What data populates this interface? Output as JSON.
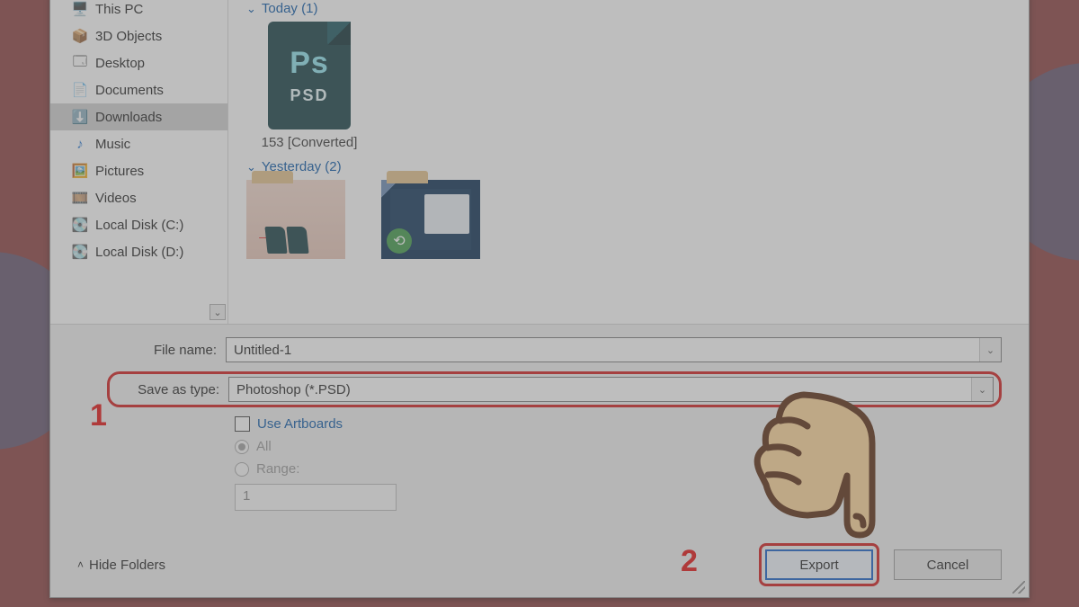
{
  "sidebar": {
    "items": [
      {
        "label": "This PC",
        "icon": "🖥️"
      },
      {
        "label": "3D Objects",
        "icon": "📦"
      },
      {
        "label": "Desktop",
        "icon": "🗔"
      },
      {
        "label": "Documents",
        "icon": "📄"
      },
      {
        "label": "Downloads",
        "icon": "⬇️",
        "selected": true
      },
      {
        "label": "Music",
        "icon": "♪"
      },
      {
        "label": "Pictures",
        "icon": "🖼️"
      },
      {
        "label": "Videos",
        "icon": "🎞️"
      },
      {
        "label": "Local Disk (C:)",
        "icon": "💽"
      },
      {
        "label": "Local Disk (D:)",
        "icon": "💽"
      }
    ]
  },
  "filearea": {
    "groups": [
      {
        "label": "Today (1)"
      },
      {
        "label": "Yesterday (2)"
      }
    ],
    "psd_file": {
      "label": "153 [Converted]",
      "ps": "Ps",
      "psd": "PSD"
    }
  },
  "form": {
    "filename_label": "File name:",
    "filename_value": "Untitled-1",
    "savetype_label": "Save as type:",
    "savetype_value": "Photoshop (*.PSD)",
    "use_artboards": "Use Artboards",
    "all_label": "All",
    "range_label": "Range:",
    "range_value": "1"
  },
  "footer": {
    "hide_folders": "Hide Folders",
    "export": "Export",
    "cancel": "Cancel"
  },
  "annotations": {
    "step1": "1",
    "step2": "2"
  }
}
